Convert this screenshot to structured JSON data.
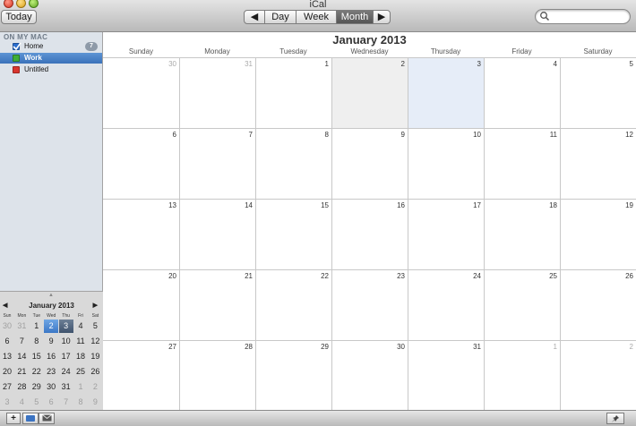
{
  "window": {
    "title": "iCal"
  },
  "toolbar": {
    "today_label": "Today",
    "prev_label": "◀",
    "next_label": "▶",
    "views": [
      "Day",
      "Week",
      "Month"
    ],
    "active_view": "Month",
    "search_placeholder": ""
  },
  "sidebar": {
    "section_label": "ON MY MAC",
    "items": [
      {
        "label": "Home",
        "checked": true,
        "color": "#2c6fce",
        "badge": "7",
        "selected": false
      },
      {
        "label": "Work",
        "checked": true,
        "color": "#3fae37",
        "badge": "",
        "selected": true
      },
      {
        "label": "Untitled",
        "checked": true,
        "color": "#d8362f",
        "badge": "",
        "selected": false
      }
    ]
  },
  "mini_calendar": {
    "title": "January 2013",
    "prev": "◀",
    "next": "▶",
    "dow": [
      "Sun",
      "Mon",
      "Tue",
      "Wed",
      "Thu",
      "Fri",
      "Sat"
    ],
    "weeks": [
      [
        {
          "d": "30",
          "o": true
        },
        {
          "d": "31",
          "o": true
        },
        {
          "d": "1"
        },
        {
          "d": "2",
          "s": "sel"
        },
        {
          "d": "3",
          "s": "today"
        },
        {
          "d": "4"
        },
        {
          "d": "5"
        }
      ],
      [
        {
          "d": "6"
        },
        {
          "d": "7"
        },
        {
          "d": "8"
        },
        {
          "d": "9"
        },
        {
          "d": "10"
        },
        {
          "d": "11"
        },
        {
          "d": "12"
        }
      ],
      [
        {
          "d": "13"
        },
        {
          "d": "14"
        },
        {
          "d": "15"
        },
        {
          "d": "16"
        },
        {
          "d": "17"
        },
        {
          "d": "18"
        },
        {
          "d": "19"
        }
      ],
      [
        {
          "d": "20"
        },
        {
          "d": "21"
        },
        {
          "d": "22"
        },
        {
          "d": "23"
        },
        {
          "d": "24"
        },
        {
          "d": "25"
        },
        {
          "d": "26"
        }
      ],
      [
        {
          "d": "27"
        },
        {
          "d": "28"
        },
        {
          "d": "29"
        },
        {
          "d": "30"
        },
        {
          "d": "31"
        },
        {
          "d": "1",
          "o": true
        },
        {
          "d": "2",
          "o": true
        }
      ],
      [
        {
          "d": "3",
          "o": true
        },
        {
          "d": "4",
          "o": true
        },
        {
          "d": "5",
          "o": true
        },
        {
          "d": "6",
          "o": true
        },
        {
          "d": "7",
          "o": true
        },
        {
          "d": "8",
          "o": true
        },
        {
          "d": "9",
          "o": true
        }
      ]
    ]
  },
  "month_view": {
    "title": "January 2013",
    "days_of_week": [
      "Sunday",
      "Monday",
      "Tuesday",
      "Wednesday",
      "Thursday",
      "Friday",
      "Saturday"
    ],
    "weeks": [
      [
        {
          "d": "30",
          "o": true
        },
        {
          "d": "31",
          "o": true
        },
        {
          "d": "1"
        },
        {
          "d": "2",
          "hl": "gray"
        },
        {
          "d": "3",
          "hl": "today"
        },
        {
          "d": "4"
        },
        {
          "d": "5"
        }
      ],
      [
        {
          "d": "6"
        },
        {
          "d": "7"
        },
        {
          "d": "8"
        },
        {
          "d": "9"
        },
        {
          "d": "10"
        },
        {
          "d": "11"
        },
        {
          "d": "12"
        }
      ],
      [
        {
          "d": "13"
        },
        {
          "d": "14"
        },
        {
          "d": "15"
        },
        {
          "d": "16"
        },
        {
          "d": "17"
        },
        {
          "d": "18"
        },
        {
          "d": "19"
        }
      ],
      [
        {
          "d": "20"
        },
        {
          "d": "21"
        },
        {
          "d": "22"
        },
        {
          "d": "23"
        },
        {
          "d": "24"
        },
        {
          "d": "25"
        },
        {
          "d": "26"
        }
      ],
      [
        {
          "d": "27"
        },
        {
          "d": "28"
        },
        {
          "d": "29"
        },
        {
          "d": "30"
        },
        {
          "d": "31"
        },
        {
          "d": "1",
          "o": true
        },
        {
          "d": "2",
          "o": true
        }
      ]
    ]
  },
  "bottom_bar": {
    "add_label": "+",
    "pin_label": "📌"
  }
}
